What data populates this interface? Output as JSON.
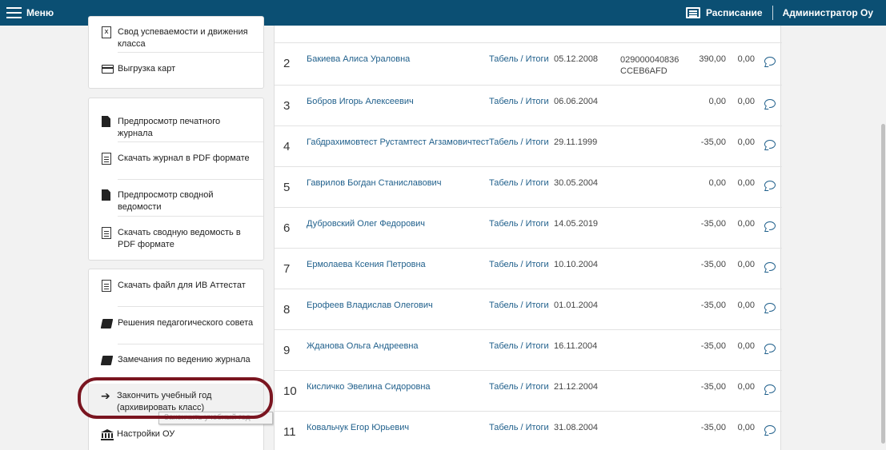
{
  "topbar": {
    "menu_label": "Меню",
    "schedule_label": "Расписание",
    "user_label": "Администратор Оу",
    "bg_color": "#0b4f73"
  },
  "sidebar": {
    "card1": [
      {
        "label": "Свод успеваемости и движения класса",
        "icon": "excel-file-icon"
      },
      {
        "label": "Выгрузка карт",
        "icon": "credit-card-icon"
      }
    ],
    "card2": [
      {
        "label": "Предпросмотр печатного журнала",
        "icon": "file-icon"
      },
      {
        "label": "Скачать журнал в PDF формате",
        "icon": "file-text-icon"
      },
      {
        "label": "Предпросмотр сводной ведомости",
        "icon": "file-icon"
      },
      {
        "label": "Скачать сводную ведомость в PDF формате",
        "icon": "file-text-icon"
      }
    ],
    "card3": [
      {
        "label": "Скачать файл для ИВ Аттестат",
        "icon": "file-text-icon"
      },
      {
        "label": "Решения педагогического совета",
        "icon": "book-icon"
      },
      {
        "label": "Замечания по ведению журнала",
        "icon": "book-icon"
      },
      {
        "label": "Закончить учебный год (архивировать класс)",
        "icon": "arrow-right-icon"
      },
      {
        "label": "Настройки ОУ",
        "icon": "bank-icon"
      }
    ],
    "tooltip": "Закончить учебный год"
  },
  "students": [
    {
      "num": "2",
      "name": "Бакиева Алиса Ураловна",
      "tabel": "Табель",
      "itogi": "Итоги",
      "date": "05.12.2008",
      "code1": "029000040836",
      "code2": "CCEB6AFD",
      "v1": "390,00",
      "v2": "0,00"
    },
    {
      "num": "3",
      "name": "Бобров Игорь Алексеевич",
      "tabel": "Табель",
      "itogi": "Итоги",
      "date": "06.06.2004",
      "code1": "",
      "code2": "",
      "v1": "0,00",
      "v2": "0,00"
    },
    {
      "num": "4",
      "name": "Габдрахимовтест Рустамтест Агзамовичтест",
      "tabel": "Табель",
      "itogi": "Итоги",
      "date": "29.11.1999",
      "code1": "",
      "code2": "",
      "v1": "-35,00",
      "v2": "0,00"
    },
    {
      "num": "5",
      "name": "Гаврилов Богдан Станиславович",
      "tabel": "Табель",
      "itogi": "Итоги",
      "date": "30.05.2004",
      "code1": "",
      "code2": "",
      "v1": "0,00",
      "v2": "0,00"
    },
    {
      "num": "6",
      "name": "Дубровский Олег Федорович",
      "tabel": "Табель",
      "itogi": "Итоги",
      "date": "14.05.2019",
      "code1": "",
      "code2": "",
      "v1": "-35,00",
      "v2": "0,00"
    },
    {
      "num": "7",
      "name": "Ермолаева Ксения Петровна",
      "tabel": "Табель",
      "itogi": "Итоги",
      "date": "10.10.2004",
      "code1": "",
      "code2": "",
      "v1": "-35,00",
      "v2": "0,00"
    },
    {
      "num": "8",
      "name": "Ерофеев Владислав Олегович",
      "tabel": "Табель",
      "itogi": "Итоги",
      "date": "01.01.2004",
      "code1": "",
      "code2": "",
      "v1": "-35,00",
      "v2": "0,00"
    },
    {
      "num": "9",
      "name": "Жданова Ольга Андреевна",
      "tabel": "Табель",
      "itogi": "Итоги",
      "date": "16.11.2004",
      "code1": "",
      "code2": "",
      "v1": "-35,00",
      "v2": "0,00"
    },
    {
      "num": "10",
      "name": "Кисличко Эвелина Сидоровна",
      "tabel": "Табель",
      "itogi": "Итоги",
      "date": "21.12.2004",
      "code1": "",
      "code2": "",
      "v1": "-35,00",
      "v2": "0,00"
    },
    {
      "num": "11",
      "name": "Ковальчук Егор Юрьевич",
      "tabel": "Табель",
      "itogi": "Итоги",
      "date": "31.08.2004",
      "code1": "",
      "code2": "",
      "v1": "-35,00",
      "v2": "0,00"
    }
  ]
}
